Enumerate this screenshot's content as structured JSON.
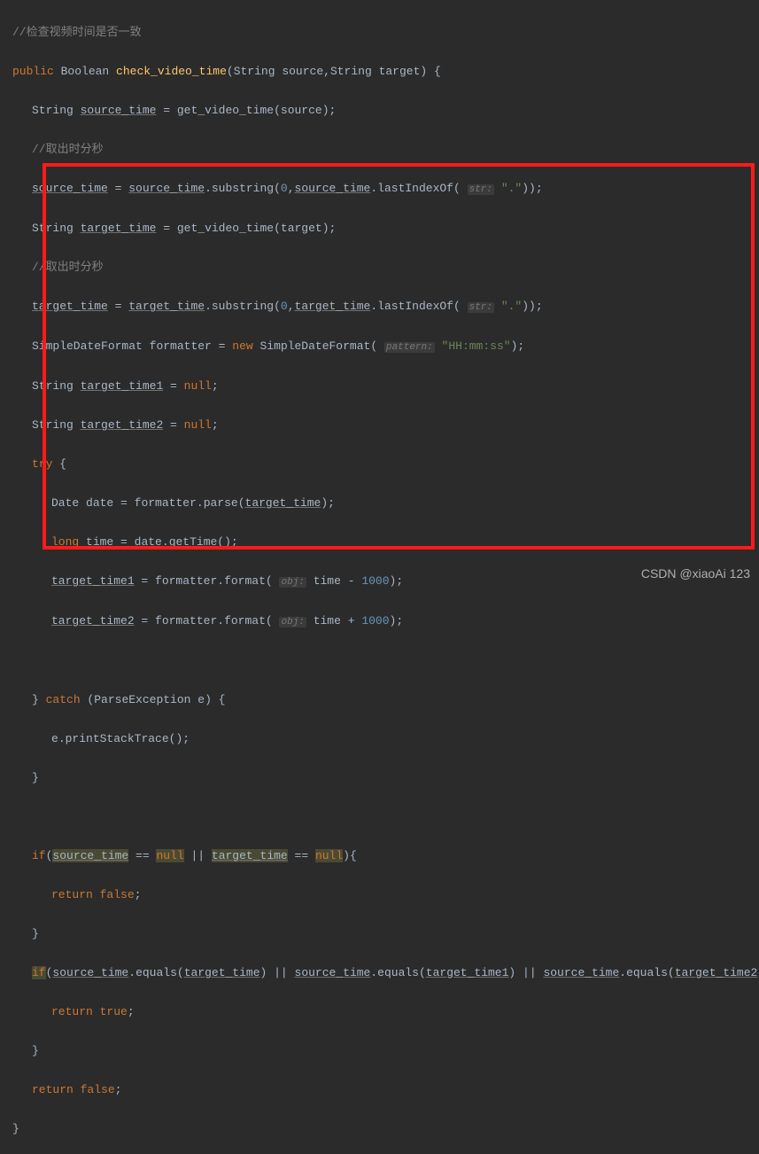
{
  "code": {
    "c1": "//检查视频时间是否一致",
    "kw_public": "public",
    "type_boolean": "Boolean",
    "m_name": "check_video_time",
    "type_string": "String",
    "p_source": "source",
    "p_target": "target",
    "v_source_time": "source_time",
    "m_get_video_time": "get_video_time",
    "c2": "//取出时分秒",
    "m_substring": "substring",
    "n_zero": "0",
    "m_lastIndexOf": "lastIndexOf",
    "hint_str": "str:",
    "s_dot": "\".\"",
    "v_target_time": "target_time",
    "type_sdf": "SimpleDateFormat",
    "v_formatter": "formatter",
    "kw_new": "new",
    "hint_pattern": "pattern:",
    "s_hhmmss": "\"HH:mm:ss\"",
    "v_target_time1": "target_time1",
    "v_target_time2": "target_time2",
    "kw_null": "null",
    "kw_try": "try",
    "type_date": "Date",
    "v_date": "date",
    "m_parse": "parse",
    "kw_long": "long",
    "v_time": "time",
    "m_getTime": "getTime",
    "m_format": "format",
    "hint_obj": "obj:",
    "n_1000": "1000",
    "kw_catch": "catch",
    "type_pe": "ParseException",
    "v_e": "e",
    "m_print": "printStackTrace",
    "kw_if": "if",
    "kw_return": "return",
    "kw_false": "false",
    "kw_true": "true",
    "m_equals": "equals"
  },
  "watermark": "CSDN @xiaoAi 123",
  "chart_data": null
}
